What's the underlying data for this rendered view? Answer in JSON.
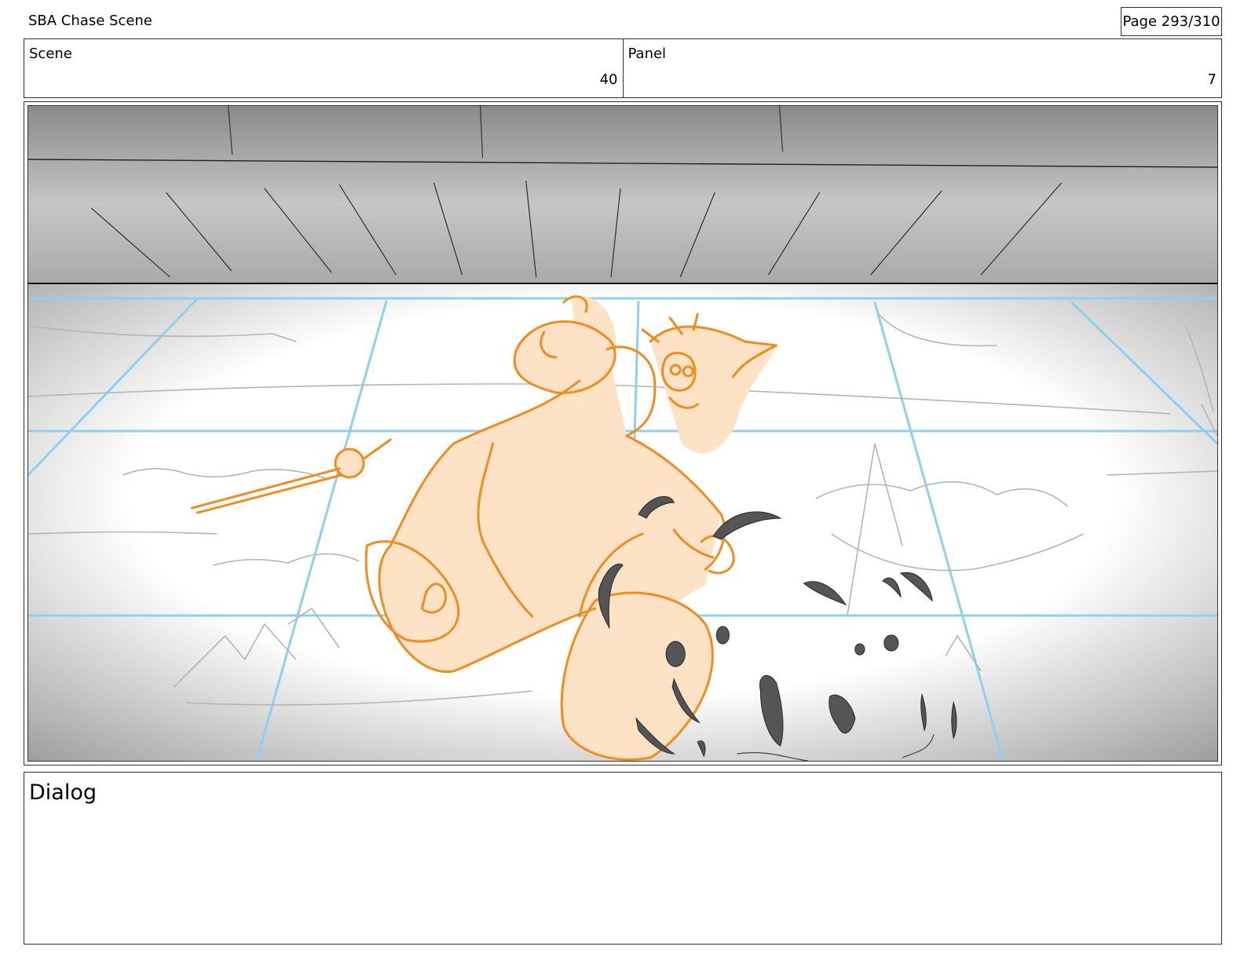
{
  "header": {
    "title": "SBA Chase Scene",
    "page": "Page 293/310"
  },
  "info": {
    "scene_label": "Scene",
    "scene_value": "40",
    "panel_label": "Panel",
    "panel_value": "7"
  },
  "panel": {
    "image": "storyboard-sketch-character-leaping-icy-floor",
    "colors": {
      "character_line": "#f28c1e",
      "character_fill": "#fde2c6",
      "guide_lines": "#8fd0f0",
      "claws": "#4a4a4a"
    }
  },
  "dialog": {
    "label": "Dialog"
  }
}
